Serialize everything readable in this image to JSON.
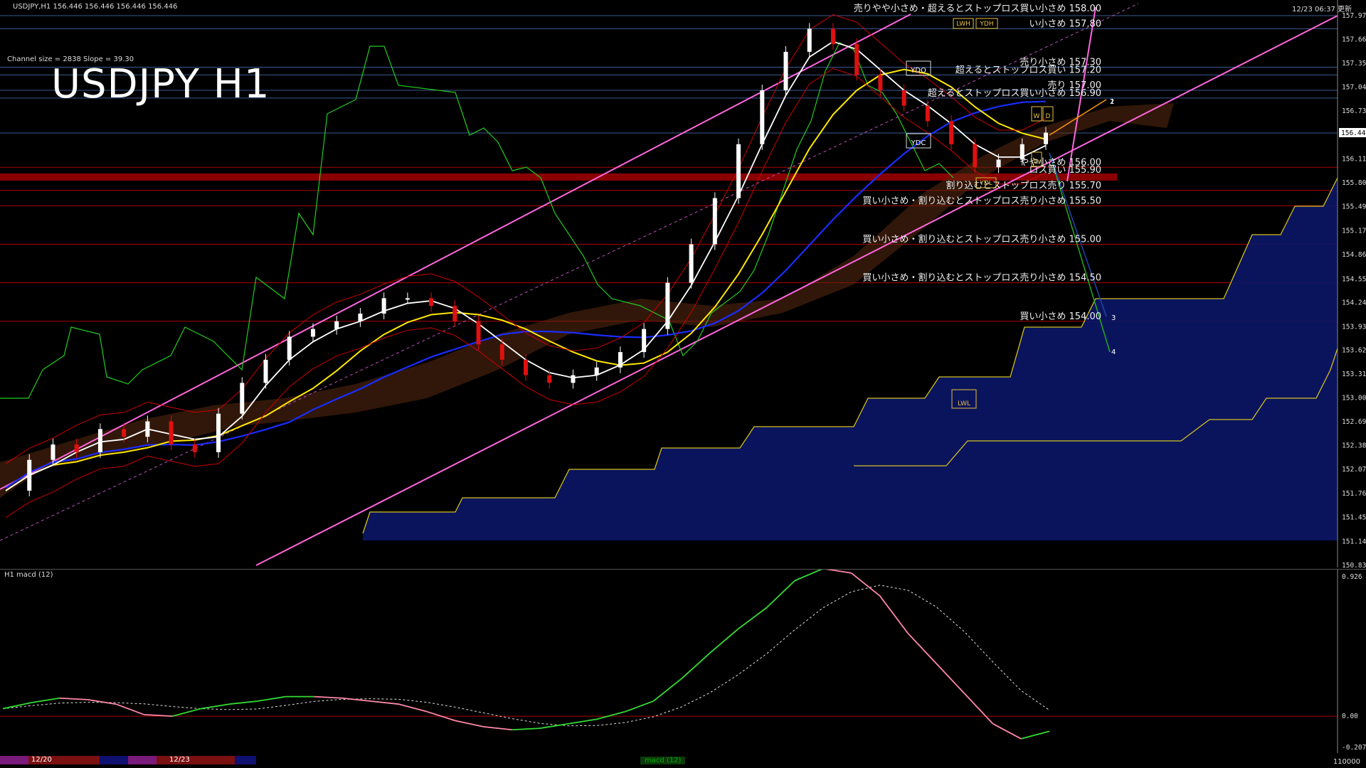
{
  "header": {
    "symbol_info": "USDJPY,H1  156.446 156.446 156.446 156.446",
    "datetime": "12/23 06:37 更新",
    "channel_info": "Channel size = 2838 Slope = 39.30",
    "title": "USDJPY H1"
  },
  "price_axis": {
    "labels": [
      "157.970",
      "157.660",
      "157.350",
      "157.040",
      "156.730",
      "156.110",
      "155.800",
      "155.490",
      "155.175",
      "154.865",
      "154.550",
      "154.245",
      "153.930",
      "153.625",
      "153.315",
      "153.005",
      "152.695",
      "152.385",
      "152.075",
      "151.765",
      "151.455",
      "151.140",
      "150.830"
    ],
    "current_price": "156.446",
    "range": [
      150.83,
      157.97
    ]
  },
  "levels": [
    {
      "text": "売りやや小さめ・超えるとストップロス買い小さめ 158.00",
      "price": 158.0
    },
    {
      "text": "い小さめ 157.80",
      "price": 157.8
    },
    {
      "text": "売り小さめ 157.30",
      "price": 157.3
    },
    {
      "text": "超えるとストップロス買い 157.20",
      "price": 157.2
    },
    {
      "text": "売り 157.00",
      "price": 157.0
    },
    {
      "text": "超えるとストップロス買い小さめ 156.90",
      "price": 156.9
    },
    {
      "text": "やや小さめ 156.00",
      "price": 156.0
    },
    {
      "text": "ロス買い 155.90",
      "price": 155.9
    },
    {
      "text": "割り込むとストップロス売り 155.70",
      "price": 155.7
    },
    {
      "text": "買い小さめ・割り込むとストップロス売り小さめ 155.50",
      "price": 155.5
    },
    {
      "text": "買い小さめ・割り込むとストップロス売り小さめ 155.00",
      "price": 155.0
    },
    {
      "text": "買い小さめ・割り込むとストップロス売り小さめ 154.50",
      "price": 154.5
    },
    {
      "text": "買い小さめ 154.00",
      "price": 154.0
    }
  ],
  "tags": {
    "lwh": "LWH",
    "ydh": "YDH",
    "ydo": "YDO",
    "ydc": "YDC",
    "ydl": "YDL",
    "lwl": "LWL",
    "w": "W",
    "d": "D",
    "m1": "1",
    "m2": "2",
    "m3": "3",
    "m4": "4"
  },
  "subwindow": {
    "title": "H1 macd (12)",
    "axis_labels": [
      "0.926",
      "0.00",
      "-0.207"
    ]
  },
  "bottom": {
    "dates": [
      "12/20",
      "12/23"
    ],
    "macd_tab": "macd (12)",
    "right_value": "110000"
  },
  "colors": {
    "price_up": "#ffffff",
    "price_down": "#e01010",
    "ma_white": "#ffffff",
    "ma_yellow": "#ffe800",
    "ma_blue": "#1a2cff",
    "green_line": "#22cc22",
    "channel": "#ff66dd",
    "macd_up": "#33dd33",
    "macd_down": "#ff88aa",
    "grid_red": "#aa0000",
    "grid_blue": "#3a5a90"
  },
  "chart_data": [
    {
      "type": "line",
      "title": "USDJPY H1",
      "series": [
        {
          "name": "",
          "values": [
            151.8,
            152.2,
            152.4,
            152.3,
            152.6,
            152.5,
            152.7,
            152.4,
            152.3,
            152.8,
            153.2,
            153.5,
            153.8,
            153.9,
            154.0,
            154.1,
            154.3,
            154.3,
            154.2,
            154.0,
            153.7,
            153.5,
            153.3,
            153.2,
            153.3,
            153.4,
            153.6,
            153.9,
            154.5,
            155.0,
            155.6,
            156.3,
            157.0,
            157.5,
            157.8,
            157.6,
            157.2,
            157.0,
            156.8,
            156.6,
            156.3,
            156.0,
            156.1,
            156.3,
            156.45
          ]
        }
      ],
      "ylim": [
        150.83,
        157.97
      ],
      "grid": false
    },
    {
      "type": "line",
      "title": "H1 macd (12)",
      "series": [
        {
          "name": "",
          "values": [
            0.05,
            0.09,
            0.12,
            0.11,
            0.08,
            0.01,
            0.0,
            0.05,
            0.08,
            0.1,
            0.13,
            0.13,
            0.12,
            0.1,
            0.08,
            0.03,
            -0.03,
            -0.07,
            -0.09,
            -0.08,
            -0.05,
            -0.02,
            0.03,
            0.1,
            0.25,
            0.42,
            0.58,
            0.72,
            0.9,
            0.98,
            0.95,
            0.8,
            0.55,
            0.35,
            0.15,
            -0.05,
            -0.15,
            -0.1
          ]
        }
      ],
      "ylim": [
        -0.207,
        0.926
      ]
    }
  ]
}
